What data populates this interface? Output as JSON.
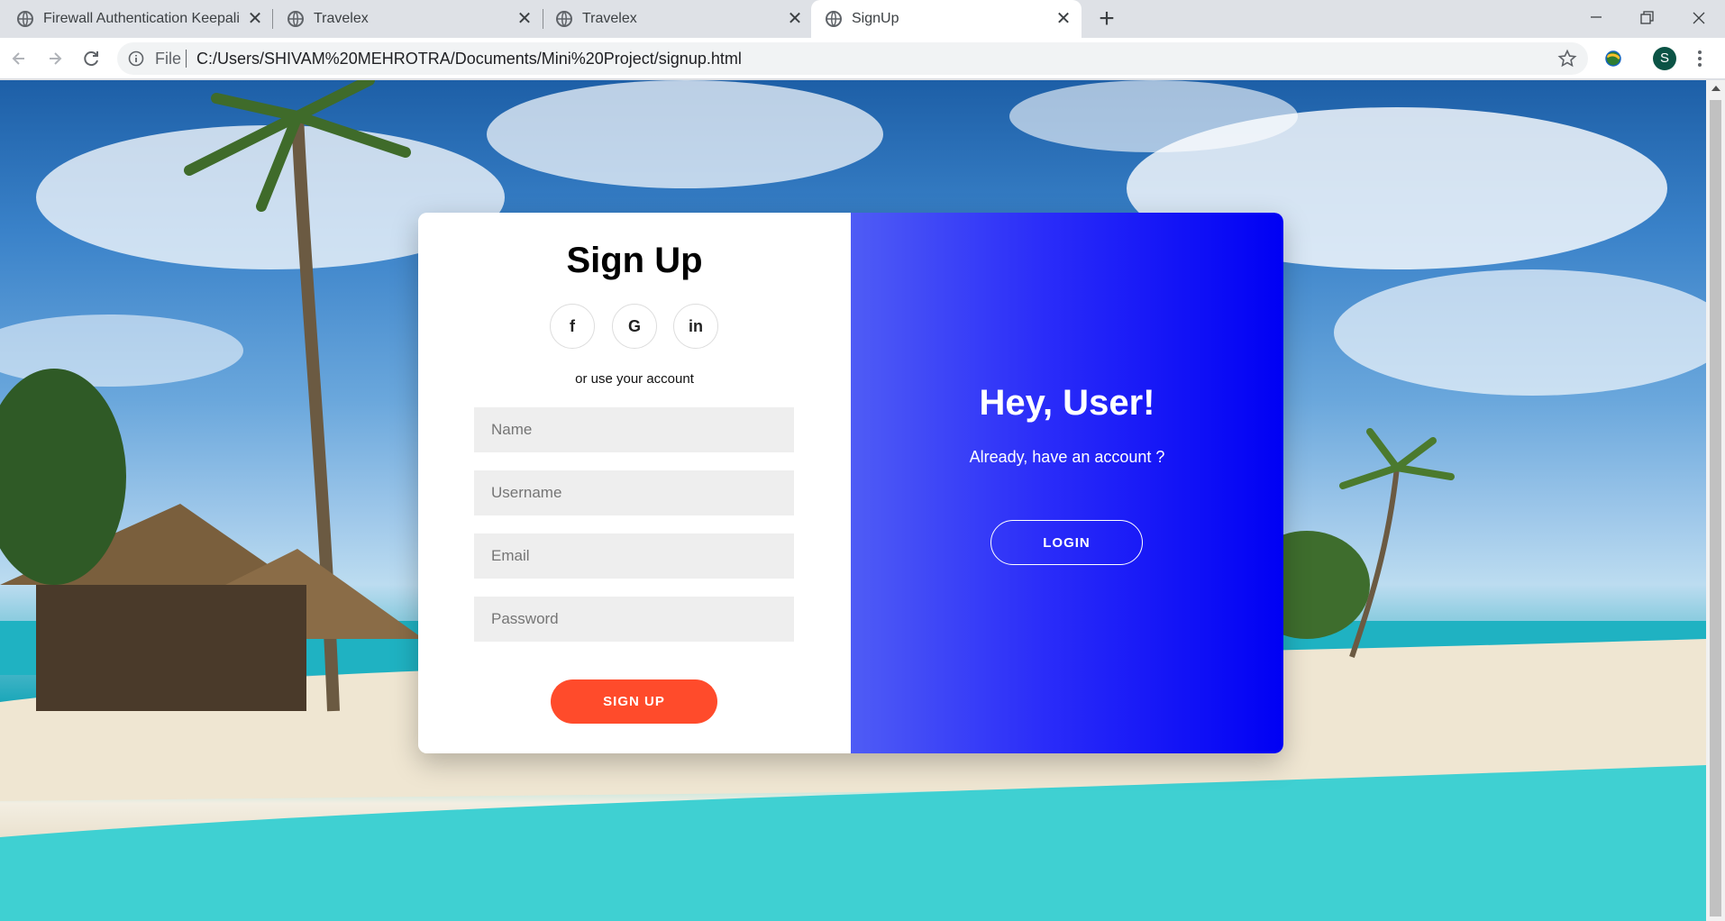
{
  "browser": {
    "tabs": [
      {
        "title": "Firewall Authentication Keepalive",
        "active": false
      },
      {
        "title": "Travelex",
        "active": false
      },
      {
        "title": "Travelex",
        "active": false
      },
      {
        "title": "SignUp",
        "active": true
      }
    ],
    "close_glyph": "✕",
    "new_tab_glyph": "+",
    "address": {
      "scheme_label": "File",
      "url": "C:/Users/SHIVAM%20MEHROTRA/Documents/Mini%20Project/signup.html"
    },
    "profile_initial": "S",
    "avatar_color": "#0b5345"
  },
  "signup": {
    "title": "Sign Up",
    "social": [
      {
        "icon": "facebook-icon",
        "glyph": "f"
      },
      {
        "icon": "google-icon",
        "glyph": "G"
      },
      {
        "icon": "linkedin-icon",
        "glyph": "in"
      }
    ],
    "alt_text": "or use your account",
    "fields": {
      "name_placeholder": "Name",
      "username_placeholder": "Username",
      "email_placeholder": "Email",
      "password_placeholder": "Password"
    },
    "button_label": "SIGN UP",
    "button_color": "#ff4b2b"
  },
  "welcome": {
    "heading": "Hey, User!",
    "subtext": "Already, have an account ?",
    "button_label": "LOGIN",
    "gradient": [
      "#4f5cf5",
      "#0000f4"
    ]
  }
}
